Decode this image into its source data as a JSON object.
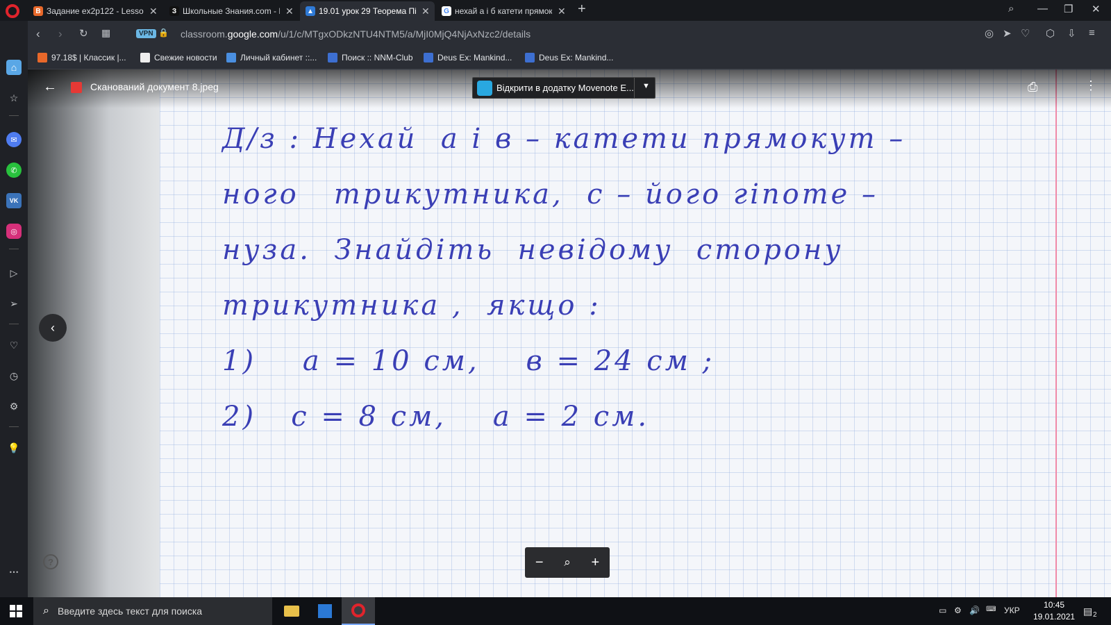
{
  "tabs": [
    {
      "title": "Задание ex2p122 - Lesson",
      "fav": "В",
      "color": "#e8682a"
    },
    {
      "title": "Школьные Знания.com - Р",
      "fav": "З",
      "color": "#111111"
    },
    {
      "title": "19.01 урок 29 Теорема Пі",
      "fav": "▲",
      "color": "#2f7ad6",
      "active": true
    },
    {
      "title": "нехай а і б катети прямок",
      "fav": "G",
      "color": "#ffffff"
    }
  ],
  "address": {
    "prefix": "classroom.",
    "domain": "google.com",
    "suffix": "/u/1/c/MTgxODkzNTU4NTM5/a/MjI0MjQ4NjAxNzc2/details",
    "vpn": "VPN"
  },
  "bookmarks": [
    {
      "label": "97.18$ | Классик |...",
      "color": "#e8682a"
    },
    {
      "label": "Свежие новости",
      "color": "#eeeeee"
    },
    {
      "label": "Личный кабинет ::...",
      "color": "#4a8fe0"
    },
    {
      "label": "Поиск :: NNM-Club",
      "color": "#3d6fd1"
    },
    {
      "label": "Deus Ex: Mankind...",
      "color": "#3d6fd1"
    },
    {
      "label": "Deus Ex: Mankind...",
      "color": "#3d6fd1"
    }
  ],
  "viewer": {
    "doc_title": "Сканований документ 8.jpeg",
    "open_with": "Відкрити в додатку Movenote E..."
  },
  "handwriting": [
    "Д/з : Нехай  а і в – катети прямокут –",
    "ного   трикутника,  с – його гіпоте –",
    "нуза.  Знайдіть  невідому  сторону",
    "трикутника ,  якщо :",
    "1)    а = 10 см,    в = 24 см ;",
    "2)   с = 8 см,    а = 2 см."
  ],
  "taskbar": {
    "search_placeholder": "Введите здесь текст для поиска",
    "lang": "УКР",
    "time": "10:45",
    "date": "19.01.2021",
    "notif_count": "2"
  }
}
